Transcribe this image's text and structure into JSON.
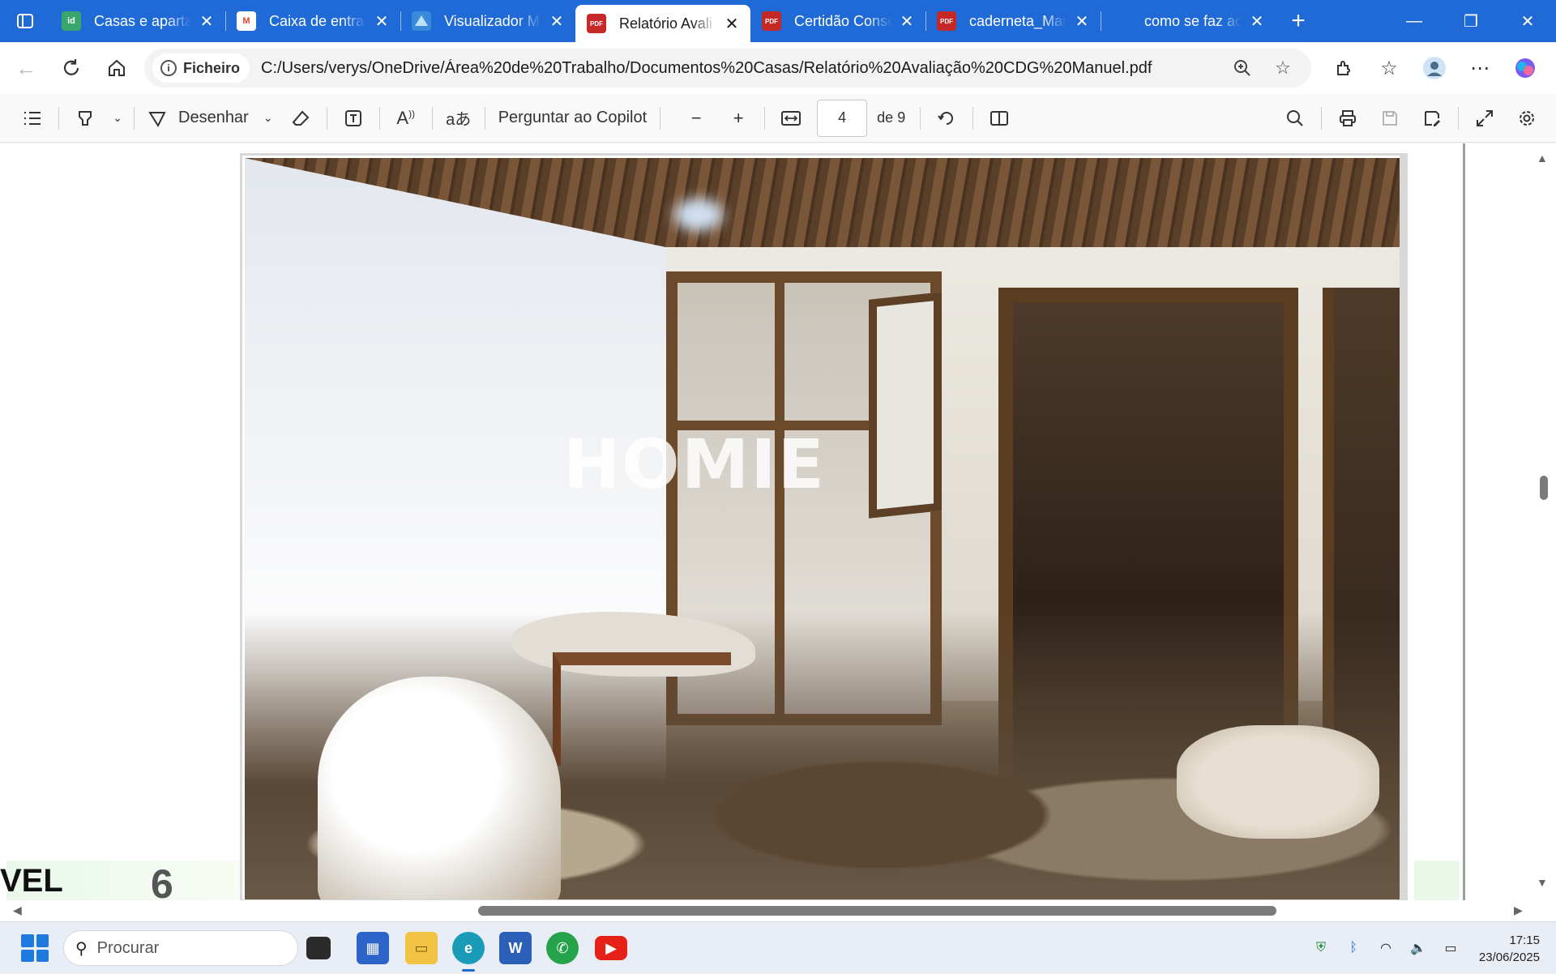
{
  "window": {
    "tabs": [
      {
        "title": "Casas e apartan",
        "favicon": "idealista-icon",
        "favicon_text": "id",
        "favicon_color": "#3aa66b",
        "active": false
      },
      {
        "title": "Caixa de entrad",
        "favicon": "gmail-icon",
        "favicon_text": "M",
        "favicon_color": "#d44638",
        "active": false
      },
      {
        "title": "Visualizador M",
        "favicon": "map-viewer-icon",
        "favicon_text": "",
        "favicon_color": "#3b8ad9",
        "active": false
      },
      {
        "title": "Relatório Avali",
        "favicon": "pdf-icon",
        "favicon_text": "PDF",
        "favicon_color": "#c62828",
        "active": true
      },
      {
        "title": "Certidão Conse",
        "favicon": "pdf-icon",
        "favicon_text": "PDF",
        "favicon_color": "#c62828",
        "active": false
      },
      {
        "title": "caderneta_Mar",
        "favicon": "pdf-icon",
        "favicon_text": "PDF",
        "favicon_color": "#c62828",
        "active": false
      },
      {
        "title": "como se faz ac",
        "favicon": "search-icon",
        "favicon_text": "",
        "favicon_color": "#1f6ad6",
        "active": false
      }
    ],
    "new_tab_label": "+",
    "controls": {
      "minimize": "—",
      "restore": "❐",
      "close": "✕"
    }
  },
  "address_bar": {
    "site_info_label": "Ficheiro",
    "url": "C:/Users/verys/OneDrive/Área%20de%20Trabalho/Documentos%20Casas/Relatório%20Avaliação%20CDG%20Manuel.pdf"
  },
  "pdf_toolbar": {
    "draw_label": "Desenhar",
    "copilot_label": "Perguntar ao Copilot",
    "current_page": "4",
    "page_count_label": "de 9"
  },
  "document": {
    "watermark": "HOMIE",
    "footer_left_text": "VEL",
    "footer_page_number": "6"
  },
  "taskbar": {
    "search_placeholder": "Procurar",
    "time": "17:15",
    "date": "23/06/2025"
  },
  "colors": {
    "tabbar_bg": "#1f6ad6",
    "active_tab_bg": "#ffffff",
    "page_footer_green": "#eaf8ea"
  }
}
